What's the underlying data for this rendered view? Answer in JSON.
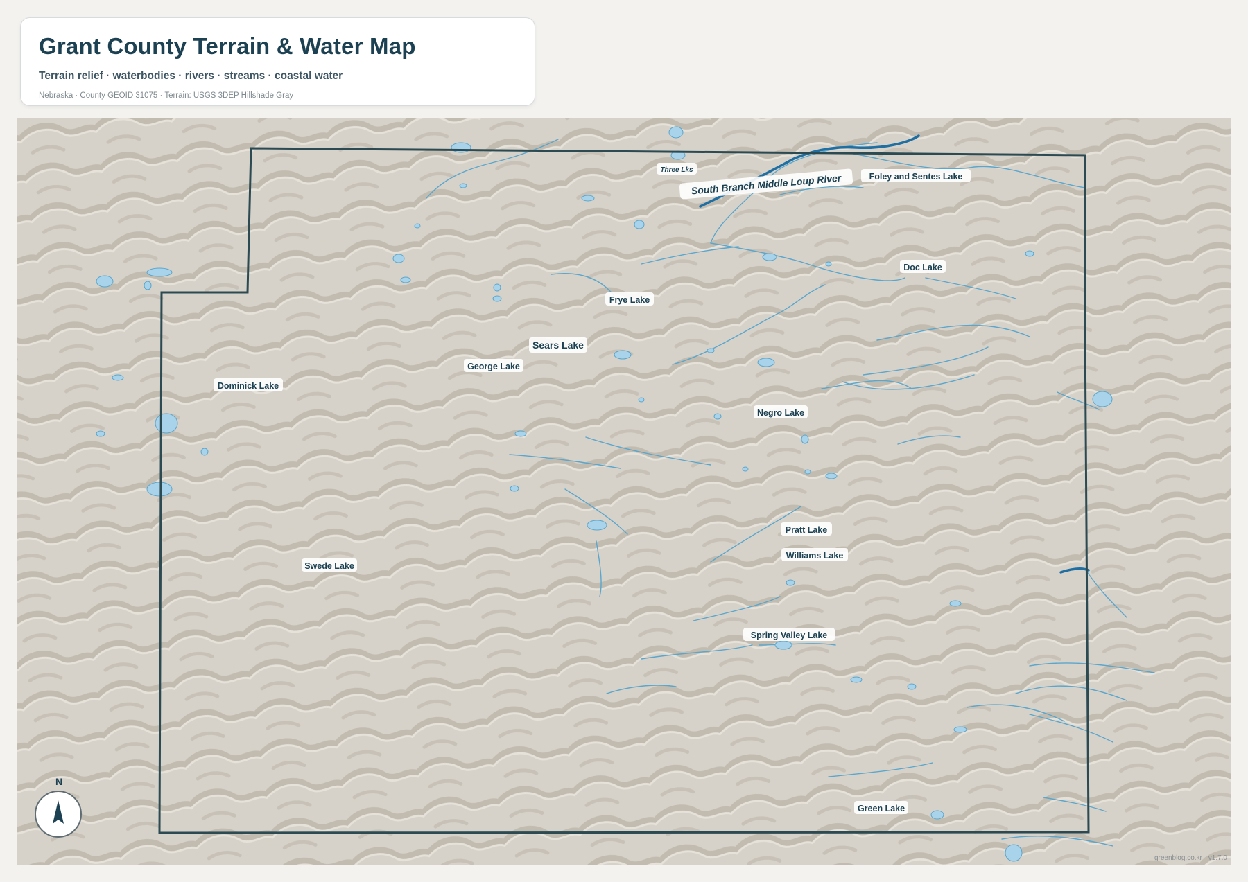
{
  "header": {
    "title": "Grant County Terrain & Water Map",
    "subtitle": "Terrain relief · waterbodies · rivers · streams · coastal water",
    "meta": "Nebraska · County GEOID 31075 · Terrain: USGS 3DEP Hillshade Gray"
  },
  "map": {
    "river_label": "South Branch Middle Loup River",
    "lake_labels": [
      "Three Lks",
      "Foley and Sentes Lake",
      "Doc Lake",
      "Frye Lake",
      "Sears Lake",
      "George Lake",
      "Dominick Lake",
      "Negro Lake",
      "Pratt Lake",
      "Williams Lake",
      "Swede Lake",
      "Spring Valley Lake",
      "Green Lake"
    ],
    "compass_label": "N",
    "attribution": "greenblog.co.kr · v1.7.0"
  },
  "colors": {
    "terrain": "#d6d1c8",
    "water": "#a9d3ea",
    "stream": "#5aa6cc",
    "river": "#1f6fa3",
    "boundary": "#2b4a52",
    "label_text": "#1c4152"
  }
}
